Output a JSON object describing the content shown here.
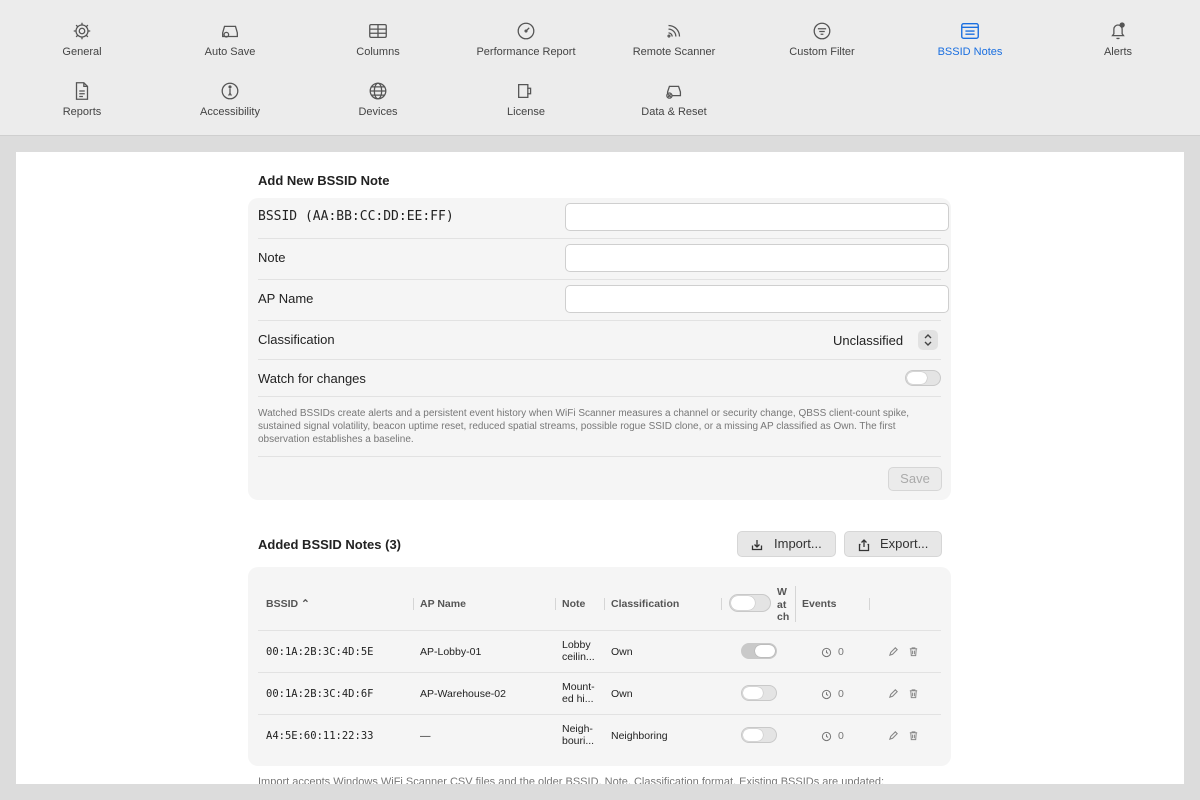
{
  "toolbar": {
    "items": [
      {
        "label": "General",
        "icon": "gear-icon"
      },
      {
        "label": "Auto Save",
        "icon": "drive-icon"
      },
      {
        "label": "Columns",
        "icon": "table-icon"
      },
      {
        "label": "Performance Report",
        "icon": "gauge-icon"
      },
      {
        "label": "Remote Scanner",
        "icon": "signal-icon"
      },
      {
        "label": "Custom Filter",
        "icon": "filter-icon"
      },
      {
        "label": "BSSID Notes",
        "icon": "notes-icon",
        "active": true
      },
      {
        "label": "Alerts",
        "icon": "bell-icon"
      },
      {
        "label": "Reports",
        "icon": "document-icon"
      },
      {
        "label": "Accessibility",
        "icon": "accessibility-icon"
      },
      {
        "label": "Devices",
        "icon": "globe-icon"
      },
      {
        "label": "License",
        "icon": "license-icon"
      },
      {
        "label": "Data & Reset",
        "icon": "drive-reset-icon"
      }
    ],
    "accent": "#1a6fe0"
  },
  "form": {
    "title": "Add New BSSID Note",
    "bssid_label": "BSSID (AA:BB:CC:DD:EE:FF)",
    "bssid_value": "",
    "note_label": "Note",
    "note_value": "",
    "ap_label": "AP Name",
    "ap_value": "",
    "class_label": "Classification",
    "class_value": "Unclassified",
    "watch_label": "Watch for changes",
    "watch_on": false,
    "help": "Watched BSSIDs create alerts and a persistent event history when WiFi Scanner measures a channel or security change, QBSS client-count spike, sustained signal volatility, beacon uptime reset, reduced spatial streams, possible rogue SSID clone, or a missing AP classified as Own. The first observation establishes a baseline.",
    "save_label": "Save"
  },
  "list": {
    "title": "Added BSSID Notes (3)",
    "import_label": "Import...",
    "export_label": "Export...",
    "columns": {
      "bssid": "BSSID",
      "ap": "AP Name",
      "note": "Note",
      "cls": "Classification",
      "watch": "W at ch",
      "events": "Events"
    },
    "rows": [
      {
        "bssid": "00:1A:2B:3C:4D:5E",
        "ap": "AP-Lobby-01",
        "note1": "Lobby",
        "note2": "ceilin...",
        "cls": "Own",
        "watch": true,
        "events": "0"
      },
      {
        "bssid": "00:1A:2B:3C:4D:6F",
        "ap": "AP-Warehouse-02",
        "note1": "Mount-",
        "note2": "ed hi...",
        "cls": "Own",
        "watch": false,
        "events": "0"
      },
      {
        "bssid": "A4:5E:60:11:22:33",
        "ap": "—",
        "note1": "Neigh-",
        "note2": "bouri...",
        "cls": "Neighboring",
        "watch": false,
        "events": "0"
      }
    ],
    "footer": "Import accepts Windows WiFi Scanner CSV files and the older BSSID, Note, Classification format. Existing BSSIDs are updated;"
  }
}
